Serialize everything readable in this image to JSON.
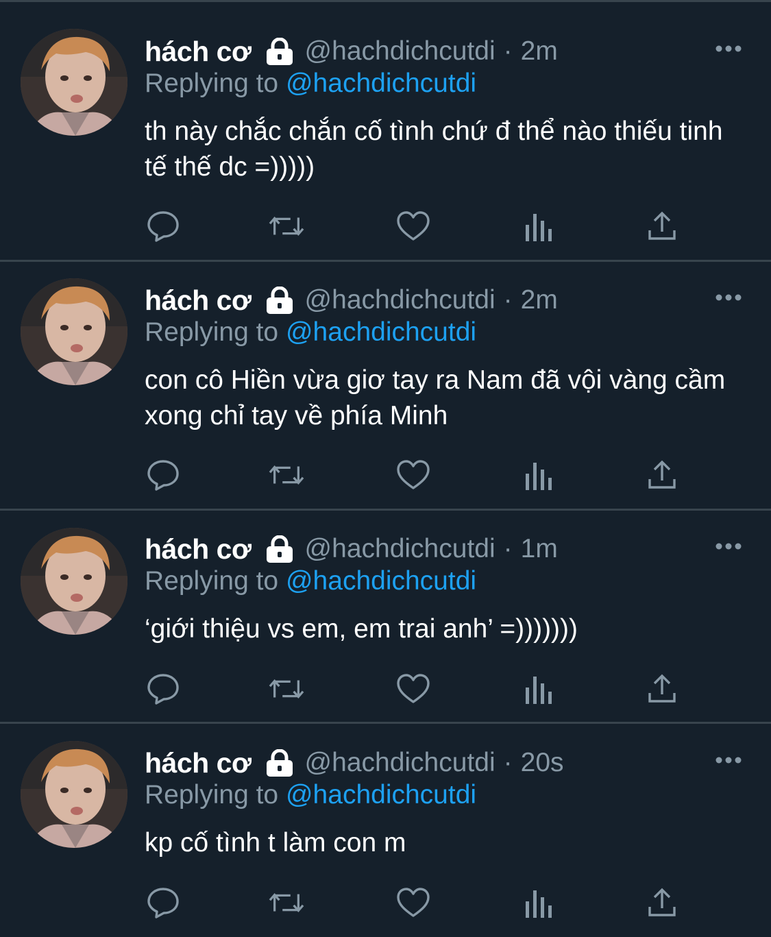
{
  "colors": {
    "background": "#15202b",
    "divider": "#38444d",
    "text_primary": "#ffffff",
    "text_secondary": "#8899a6",
    "accent": "#1da1f2"
  },
  "icons": {
    "lock": "lock-icon",
    "more": "more-icon",
    "reply": "reply-icon",
    "retweet": "retweet-icon",
    "like": "like-icon",
    "analytics": "analytics-icon",
    "share": "share-icon"
  },
  "tweets": [
    {
      "display_name": "hách cơ",
      "handle": "@hachdichcutdi",
      "separator": "·",
      "time": "2m",
      "replying_prefix": "Replying to",
      "replying_to": "@hachdichcutdi",
      "text": "th này chắc chắn cố tình chứ đ thể nào thiếu tinh tế thế dc =)))))"
    },
    {
      "display_name": "hách cơ",
      "handle": "@hachdichcutdi",
      "separator": "·",
      "time": "2m",
      "replying_prefix": "Replying to",
      "replying_to": "@hachdichcutdi",
      "text": "con cô Hiền vừa giơ tay ra Nam đã vội vàng cầm xong chỉ tay về phía Minh"
    },
    {
      "display_name": "hách cơ",
      "handle": "@hachdichcutdi",
      "separator": "·",
      "time": "1m",
      "replying_prefix": "Replying to",
      "replying_to": "@hachdichcutdi",
      "text": "‘giới thiệu vs em, em trai anh’ =)))))))"
    },
    {
      "display_name": "hách cơ",
      "handle": "@hachdichcutdi",
      "separator": "·",
      "time": "20s",
      "replying_prefix": "Replying to",
      "replying_to": "@hachdichcutdi",
      "text": "kp cố tình t làm con m"
    }
  ]
}
